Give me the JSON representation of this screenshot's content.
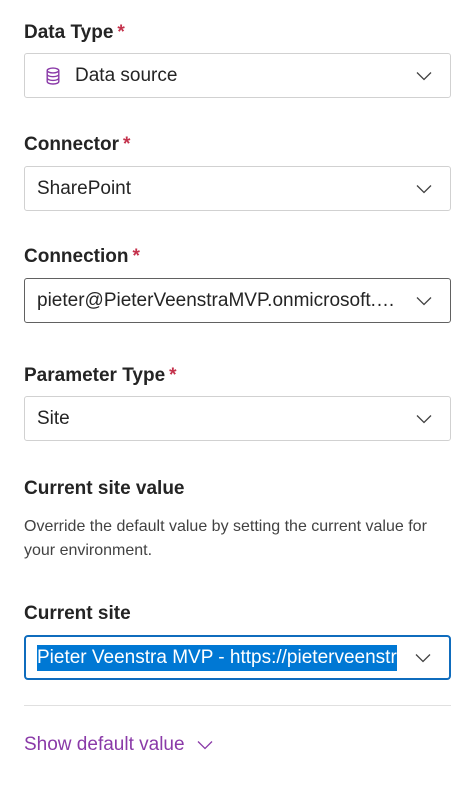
{
  "fields": {
    "data_type": {
      "label": "Data Type",
      "required_mark": "*",
      "value": "Data source",
      "icon": "database-icon"
    },
    "connector": {
      "label": "Connector",
      "required_mark": "*",
      "value": "SharePoint"
    },
    "connection": {
      "label": "Connection",
      "required_mark": "*",
      "value": "pieter@PieterVeenstraMVP.onmicrosoft.com"
    },
    "parameter_type": {
      "label": "Parameter Type",
      "required_mark": "*",
      "value": "Site"
    }
  },
  "current_site_value": {
    "heading": "Current site value",
    "description": "Override the default value by setting the current value for your environment."
  },
  "current_site": {
    "label": "Current site",
    "value": "Pieter Veenstra MVP - https://pieterveenstra"
  },
  "show_default": {
    "label": "Show default value"
  },
  "colors": {
    "required": "#c4314b",
    "link": "#8a3aa8",
    "focus_border": "#0f6cbd",
    "selection": "#0078d4"
  }
}
